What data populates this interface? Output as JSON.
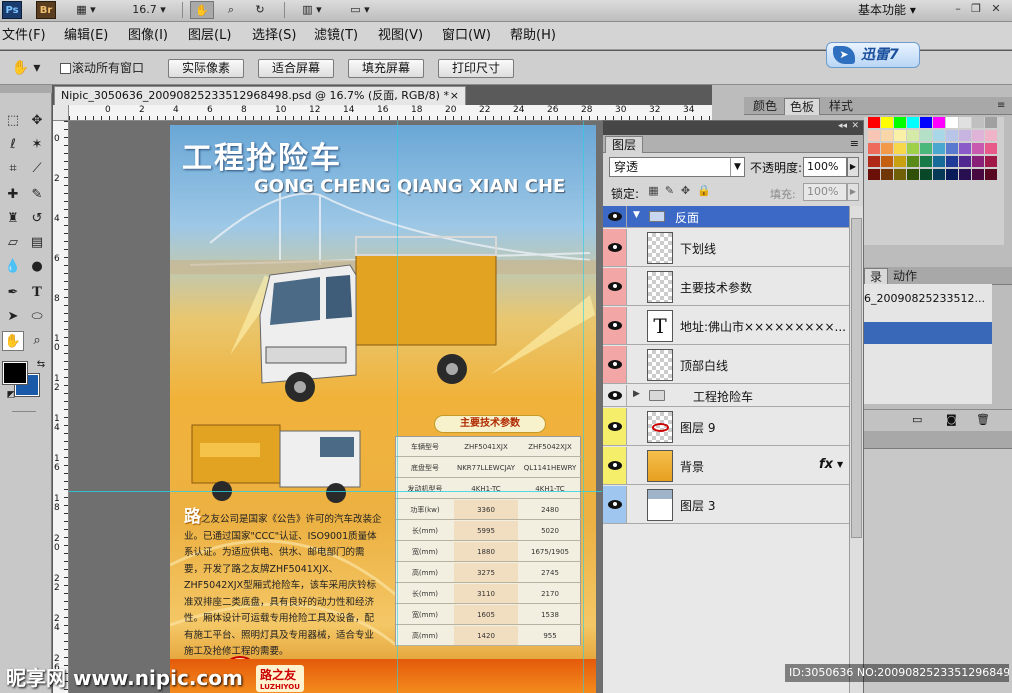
{
  "app": {
    "ps_logo": "Ps",
    "br_logo": "Br",
    "zoom": "16.7",
    "workspace": "基本功能",
    "window_controls": [
      "–",
      "❐",
      "✕"
    ]
  },
  "menu": [
    {
      "label": "文件(F)"
    },
    {
      "label": "编辑(E)"
    },
    {
      "label": "图像(I)"
    },
    {
      "label": "图层(L)"
    },
    {
      "label": "选择(S)"
    },
    {
      "label": "滤镜(T)"
    },
    {
      "label": "视图(V)"
    },
    {
      "label": "窗口(W)"
    },
    {
      "label": "帮助(H)"
    }
  ],
  "xunlei": {
    "label": "迅雷7"
  },
  "options": {
    "scroll_all_label": "滚动所有窗口",
    "buttons": [
      "实际像素",
      "适合屏幕",
      "填充屏幕",
      "打印尺寸"
    ]
  },
  "document": {
    "tab_title": "Nipic_3050636_20090825233512968498.psd @ 16.7% (反面, RGB/8) *",
    "close": "×",
    "ruler_h": [
      "0",
      "2",
      "4",
      "6",
      "8",
      "10",
      "12",
      "14",
      "16",
      "18",
      "20",
      "22",
      "24",
      "26",
      "28",
      "30",
      "32",
      "34",
      "36"
    ],
    "ruler_v": [
      "0",
      "2",
      "4",
      "6",
      "8",
      "10",
      "12",
      "14",
      "16",
      "18",
      "20",
      "22",
      "24",
      "26"
    ]
  },
  "poster": {
    "title": "工程抢险车",
    "pinyin": "GONG CHENG QIANG XIAN CHE",
    "body_lead": "路",
    "body": "之友公司是国家《公告》许可的汽车改装企业。已通过国家\"CCC\"认证、ISO9001质量体系认证。为适应供电、供水、邮电部门的需要，开发了路之友牌ZHF5041XJX、ZHF5042XJX型厢式抢险车，该车采用庆铃标准双排座二类底盘，具有良好的动力性和经济性。厢体设计可运载专用抢险工具及设备，配有施工平台、照明灯具及专用器械，适合专业施工及抢修工程的需要。",
    "spec_title": "主要技术参数",
    "spec_rows": [
      [
        "车辆型号",
        "ZHF5041XJX",
        "ZHF5042XJX"
      ],
      [
        "底盘型号",
        "NKR77LLEWCJAY",
        "QL1141HEWRY"
      ],
      [
        "发动机型号",
        "4KH1-TC",
        "4KH1-TC"
      ],
      [
        "功率(kw)",
        "3360",
        "2480"
      ],
      [
        "长(mm)",
        "5995",
        "5020"
      ],
      [
        "宽(mm)",
        "1880",
        "1675/1905"
      ],
      [
        "高(mm)",
        "3275",
        "2745"
      ],
      [
        "长(mm)",
        "3110",
        "2170"
      ],
      [
        "宽(mm)",
        "1605",
        "1538"
      ],
      [
        "高(mm)",
        "1420",
        "955"
      ]
    ],
    "brand": "路之友",
    "brand_en": "LUZHIYOU"
  },
  "watermark": {
    "left": "昵享网 www.nipic.com",
    "right": "ID:3050636 NO:20090825233512968498"
  },
  "right_panels": {
    "swatch_tabs": [
      "颜色",
      "色板",
      "样式"
    ],
    "history_tabs": [
      "录",
      "动作"
    ],
    "history_item": "6_20090825233512...",
    "swatch_colors": [
      "#ff0000",
      "#ffff00",
      "#00ff00",
      "#00ffff",
      "#0000ff",
      "#ff00ff",
      "#ffffff",
      "#e0e0e0",
      "#c0c0c0",
      "#a0a0a0",
      "#f7c6b4",
      "#f9d6a8",
      "#fbf0a8",
      "#d6eaa8",
      "#b4e0c8",
      "#a8d8e8",
      "#b8c4e8",
      "#c8b4e0",
      "#e0b4d8",
      "#f0b4c8",
      "#ee6a5a",
      "#f29a48",
      "#f7d84a",
      "#9fd04a",
      "#4ab87a",
      "#4aa8d0",
      "#5a7ad0",
      "#8a5ac8",
      "#c85ab0",
      "#e85a8a",
      "#b02818",
      "#c46010",
      "#c8a010",
      "#5a8a18",
      "#187a48",
      "#186a98",
      "#203a98",
      "#502890",
      "#882078",
      "#a01848",
      "#6a1008",
      "#703808",
      "#706008",
      "#305008",
      "#084828",
      "#083a58",
      "#081a58",
      "#281050",
      "#480840",
      "#580820"
    ]
  },
  "layers": {
    "tab": "图层",
    "blend_mode": "穿透",
    "opacity_label": "不透明度:",
    "opacity_value": "100%",
    "lock_label": "锁定:",
    "fill_label": "填充:",
    "fill_value": "100%",
    "items": [
      {
        "name": "反面",
        "type": "group-open",
        "color": "",
        "selected": true
      },
      {
        "name": "下划线",
        "type": "raster",
        "color": "#f2a6a6"
      },
      {
        "name": "主要技术参数",
        "type": "raster",
        "color": "#f2a6a6"
      },
      {
        "name": "地址:佛山市×××××××××...",
        "type": "text",
        "color": "#f2a6a6"
      },
      {
        "name": "顶部白线",
        "type": "raster",
        "color": "#f2a6a6"
      },
      {
        "name": "工程抢险车",
        "type": "group-closed",
        "color": ""
      },
      {
        "name": "图层 9",
        "type": "logo",
        "color": "#f4ee6a"
      },
      {
        "name": "背景",
        "type": "fill",
        "color": "#f4ee6a",
        "fx": "fx"
      },
      {
        "name": "图层 3",
        "type": "image",
        "color": "#9ec6ee"
      }
    ]
  }
}
